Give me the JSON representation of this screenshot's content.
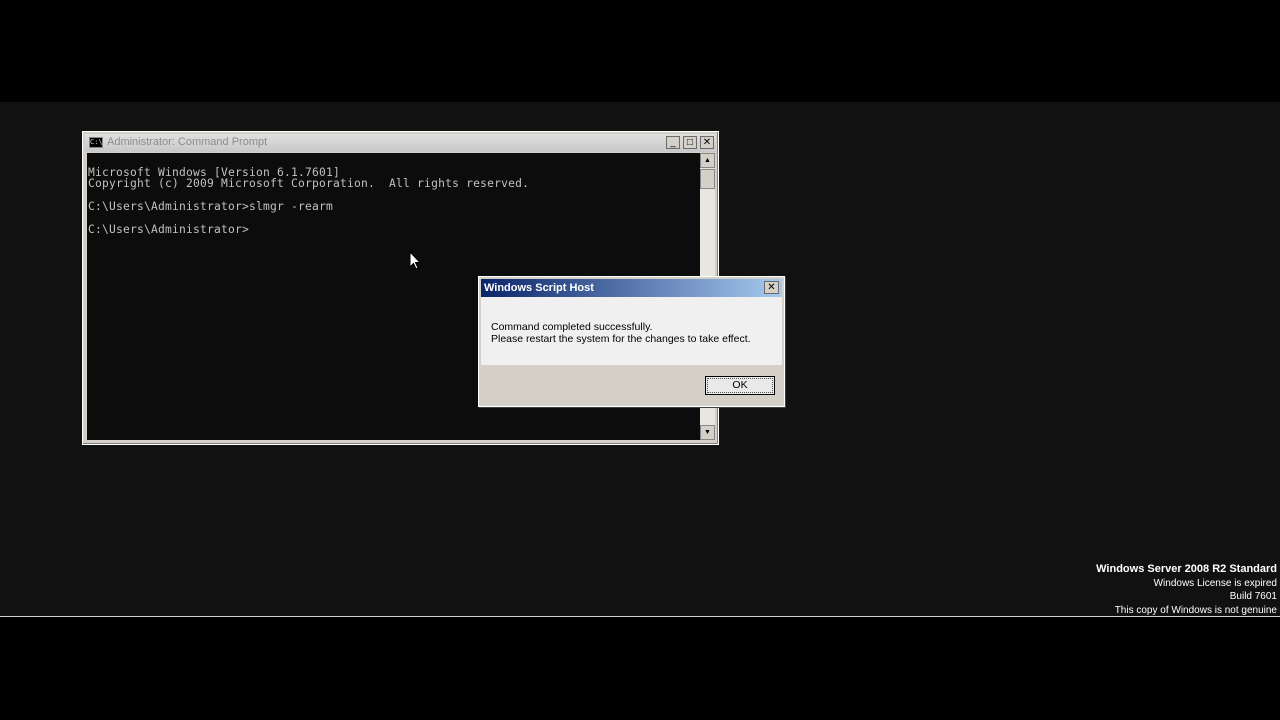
{
  "cmd_window": {
    "title": "Administrator: Command Prompt",
    "minimize": "_",
    "maximize": "□",
    "close": "✕",
    "lines": [
      "Microsoft Windows [Version 6.1.7601]",
      "Copyright (c) 2009 Microsoft Corporation.  All rights reserved.",
      "",
      "C:\\Users\\Administrator>slmgr -rearm",
      "",
      "C:\\Users\\Administrator>"
    ]
  },
  "dialog": {
    "title": "Windows Script Host",
    "close": "✕",
    "message_line1": "Command completed successfully.",
    "message_line2": "Please restart the system for the changes to take effect.",
    "ok_label": "OK"
  },
  "watermark": {
    "edition": "Windows Server 2008 R2 Standard",
    "license": "Windows License is expired",
    "build": "Build 7601",
    "genuine": "This copy of Windows is not genuine"
  },
  "colors": {
    "desktop": "#111111",
    "console_bg": "#0c0c0c",
    "console_text": "#c0c0c0",
    "dialog_title": "#0a246a"
  },
  "icons": {
    "cmd_icon": "console-icon",
    "pointer": "mouse-cursor-icon"
  }
}
